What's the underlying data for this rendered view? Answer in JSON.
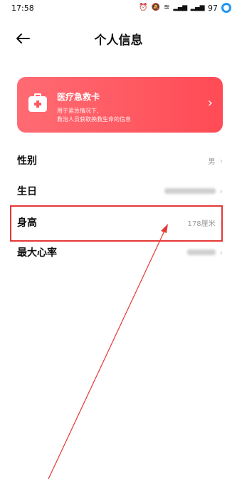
{
  "status_bar": {
    "time": "17:58",
    "battery": "97"
  },
  "header": {
    "title": "个人信息"
  },
  "emergency_card": {
    "title": "医疗急救卡",
    "desc_line1": "用于紧急情况下,",
    "desc_line2": "救治人员获取挽救生命的信息"
  },
  "rows": [
    {
      "label": "性别",
      "value": "男",
      "blurred": false
    },
    {
      "label": "生日",
      "value": "",
      "blurred": true
    },
    {
      "label": "身高",
      "value": "178厘米",
      "blurred": false
    },
    {
      "label": "最大心率",
      "value": "",
      "blurred": true
    }
  ],
  "annotation": {
    "highlight_color": "#e53935"
  },
  "colors": {
    "card_gradient_start": "#ff6b73",
    "card_gradient_end": "#ff4b55"
  }
}
